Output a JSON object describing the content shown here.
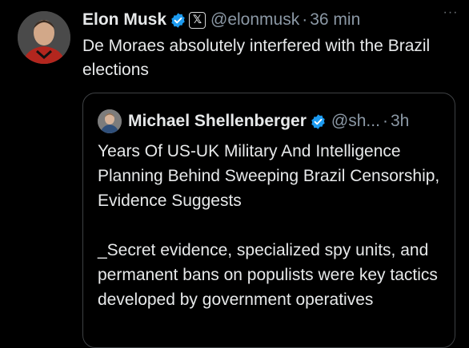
{
  "post": {
    "author_name": "Elon Musk",
    "handle": "@elonmusk",
    "separator": "·",
    "time": "36 min",
    "text": "De Moraes absolutely interfered with the Brazil elections",
    "more_icon": "···"
  },
  "quoted_post": {
    "author_name": "Michael Shellenberger",
    "handle": "@sh...",
    "separator": "·",
    "time": "3h",
    "headline": "Years Of US-UK Military And Intelligence Planning Behind Sweeping Brazil Censorship, Evidence Suggests",
    "body": "_Secret evidence, specialized spy units, and permanent bans on populists were key tactics developed by government operatives"
  },
  "colors": {
    "background": "#000000",
    "text_primary": "#e7e9ea",
    "text_secondary": "#8b98a5",
    "verified_blue": "#1d9bf0",
    "card_border": "#3e4144"
  },
  "icons": {
    "verified": "verified-badge-icon",
    "affiliate": "x-affiliate-icon",
    "more": "more-options-icon"
  },
  "affiliate_badge_text": "𝕏"
}
